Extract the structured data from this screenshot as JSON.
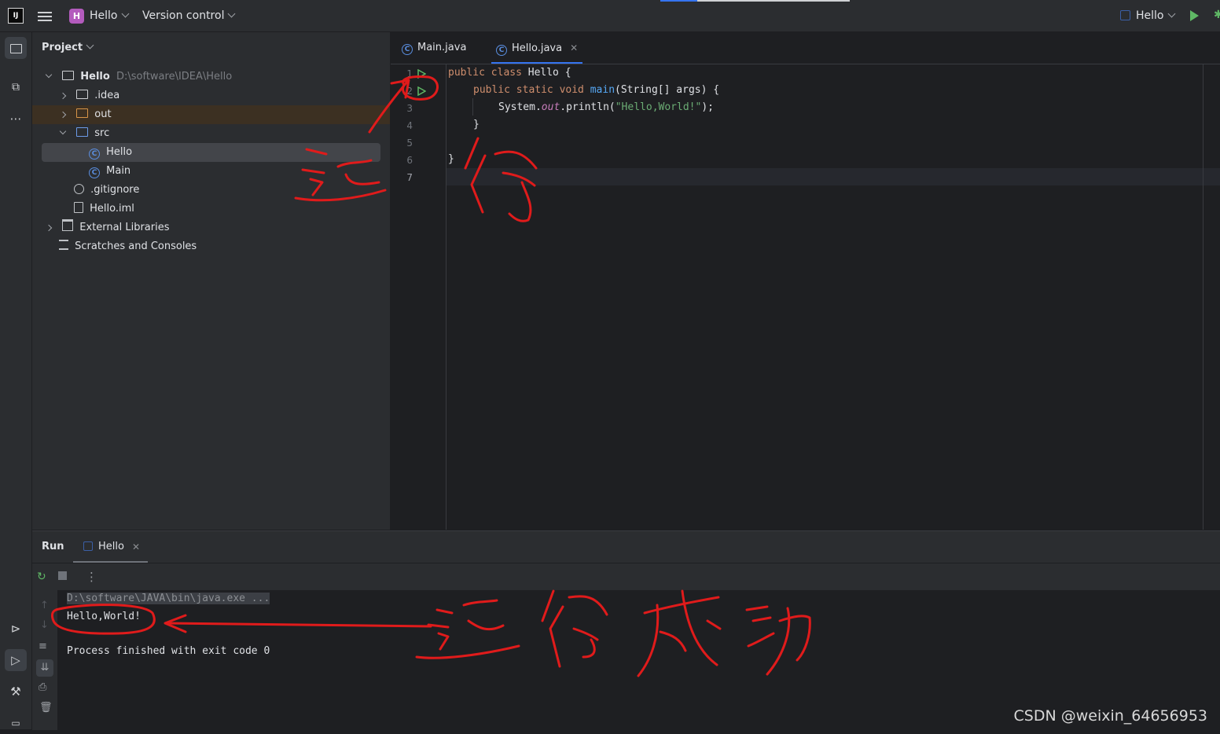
{
  "titlebar": {
    "logo_text": "IJ",
    "project_badge": "H",
    "project_name": "Hello",
    "vcs_label": "Version control",
    "run_config": "Hello"
  },
  "project_panel": {
    "title": "Project",
    "root": {
      "name": "Hello",
      "path": "D:\\software\\IDEA\\Hello"
    },
    "items": [
      {
        "label": ".idea"
      },
      {
        "label": "out"
      },
      {
        "label": "src"
      },
      {
        "label": "Hello"
      },
      {
        "label": "Main"
      },
      {
        "label": ".gitignore"
      },
      {
        "label": "Hello.iml"
      },
      {
        "label": "External Libraries"
      },
      {
        "label": "Scratches and Consoles"
      }
    ]
  },
  "editor": {
    "tabs": [
      {
        "label": "Main.java",
        "active": false
      },
      {
        "label": "Hello.java",
        "active": true
      }
    ],
    "line_numbers": [
      "1",
      "2",
      "3",
      "4",
      "5",
      "6",
      "7"
    ],
    "code": {
      "l1_kw": "public class ",
      "l1_rest": "Hello {",
      "l2_kw": "public static void ",
      "l2_fn": "main",
      "l2_rest": "(String[] args) {",
      "l3_a": "System.",
      "l3_out": "out",
      "l3_b": ".println(",
      "l3_str": "\"Hello,World!\"",
      "l3_c": ");",
      "l4": "}",
      "l6": "}"
    }
  },
  "run_panel": {
    "title": "Run",
    "tab_label": "Hello",
    "console": {
      "cmd": "D:\\software\\JAVA\\bin\\java.exe ...",
      "output": "Hello,World!",
      "exit": "Process finished with exit code 0"
    }
  },
  "annotations": {
    "color": "#e01b1b"
  },
  "watermark": "CSDN @weixin_64656953",
  "colors": {
    "accent": "#3574f0",
    "run_green": "#5fb865"
  }
}
